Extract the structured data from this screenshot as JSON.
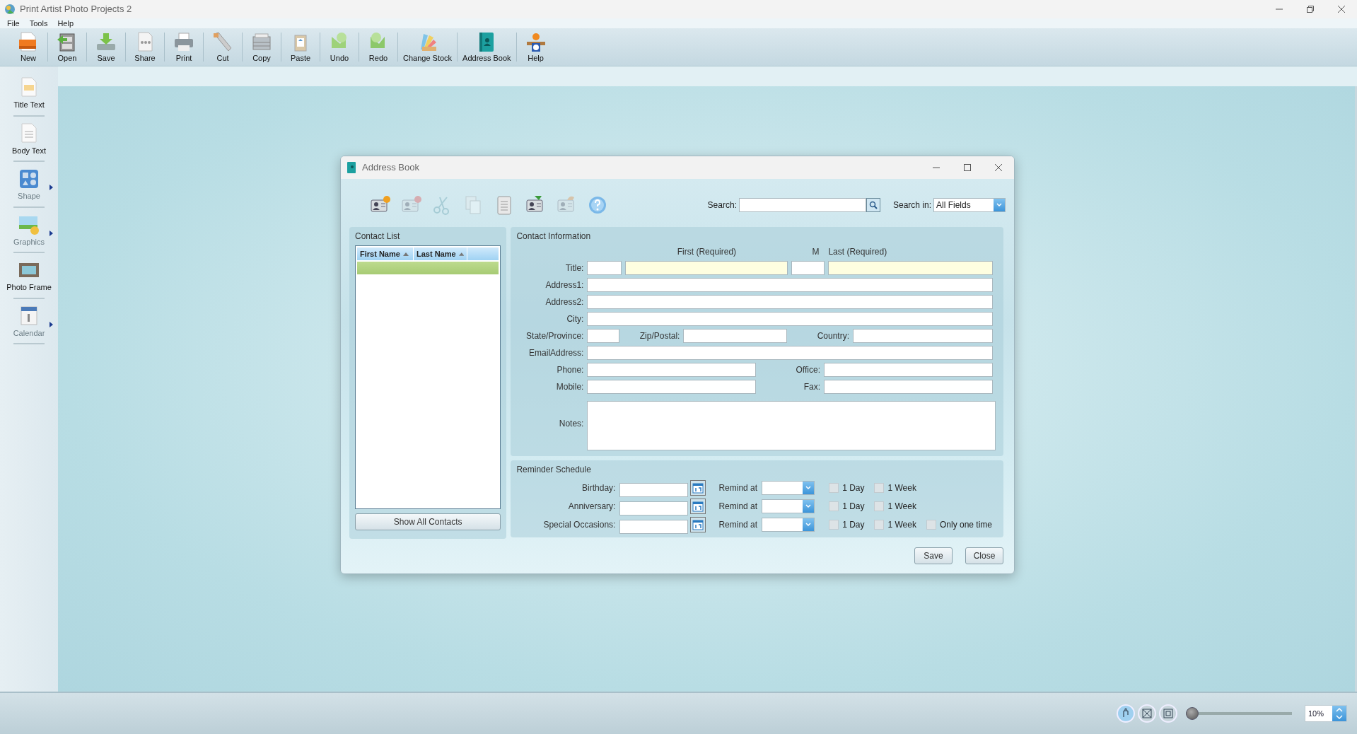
{
  "window": {
    "title": "Print Artist Photo Projects 2"
  },
  "menu": [
    "File",
    "Tools",
    "Help"
  ],
  "toolbar": [
    {
      "label": "New"
    },
    {
      "label": "Open"
    },
    {
      "label": "Save"
    },
    {
      "label": "Share"
    },
    {
      "label": "Print"
    },
    {
      "label": "Cut"
    },
    {
      "label": "Copy"
    },
    {
      "label": "Paste"
    },
    {
      "label": "Undo"
    },
    {
      "label": "Redo"
    },
    {
      "label": "Change Stock"
    },
    {
      "label": "Address Book"
    },
    {
      "label": "Help"
    }
  ],
  "sidebar": {
    "items": [
      {
        "label": "Title Text",
        "disabled": false,
        "submenu": false
      },
      {
        "label": "Body Text",
        "disabled": false,
        "submenu": false
      },
      {
        "label": "Shape",
        "disabled": true,
        "submenu": true
      },
      {
        "label": "Graphics",
        "disabled": true,
        "submenu": true
      },
      {
        "label": "Photo Frame",
        "disabled": false,
        "submenu": false
      },
      {
        "label": "Calendar",
        "disabled": true,
        "submenu": true
      }
    ]
  },
  "dialog": {
    "title": "Address Book",
    "tools": [
      {
        "disabled": false
      },
      {
        "disabled": true
      },
      {
        "disabled": true
      },
      {
        "disabled": true
      },
      {
        "disabled": false
      },
      {
        "disabled": false
      },
      {
        "disabled": true
      },
      {
        "disabled": false
      }
    ],
    "search": {
      "label": "Search:",
      "search_in_label": "Search in:",
      "search_in_value": "All Fields"
    },
    "contact_list": {
      "title": "Contact List",
      "columns": [
        "First Name",
        "Last Name"
      ],
      "rows": [
        {
          "selected": true
        }
      ],
      "button": "Show All Contacts"
    },
    "contact_info": {
      "title": "Contact Information",
      "headers": [
        "First (Required)",
        "M",
        "Last (Required)"
      ],
      "rows": [
        {
          "kind": "name",
          "label": "Title:",
          "fields": [
            {
              "required": false
            },
            {
              "required": true
            },
            {
              "required": false
            },
            {
              "required": true
            }
          ]
        },
        {
          "kind": "full",
          "label": "Address1:"
        },
        {
          "kind": "full",
          "label": "Address2:"
        },
        {
          "kind": "full",
          "label": "City:"
        },
        {
          "kind": "triple",
          "labels": [
            "State/Province:",
            "Zip/Postal:",
            "Country:"
          ]
        },
        {
          "kind": "full",
          "label": "EmailAddress:"
        },
        {
          "kind": "pair",
          "labels": [
            "Phone:",
            "Office:"
          ]
        },
        {
          "kind": "pair",
          "labels": [
            "Mobile:",
            "Fax:"
          ]
        },
        {
          "kind": "notes",
          "label": "Notes:"
        }
      ]
    },
    "reminders": {
      "title": "Reminder Schedule",
      "rows": [
        {
          "label": "Birthday:",
          "remind_label": "Remind at",
          "options": [
            {
              "label": "1 Day",
              "checked": false
            },
            {
              "label": "1 Week",
              "checked": false
            }
          ]
        },
        {
          "label": "Anniversary:",
          "remind_label": "Remind at",
          "options": [
            {
              "label": "1 Day",
              "checked": false
            },
            {
              "label": "1 Week",
              "checked": false
            }
          ]
        },
        {
          "label": "Special Occasions:",
          "remind_label": "Remind at",
          "options": [
            {
              "label": "1 Day",
              "checked": false
            },
            {
              "label": "1 Week",
              "checked": false
            },
            {
              "label": "Only one time",
              "checked": false
            }
          ]
        }
      ]
    },
    "buttons": [
      "Save",
      "Close"
    ]
  },
  "status_bar": {
    "zoom_slider": {
      "level": 0
    },
    "zoom_value": "10%"
  }
}
